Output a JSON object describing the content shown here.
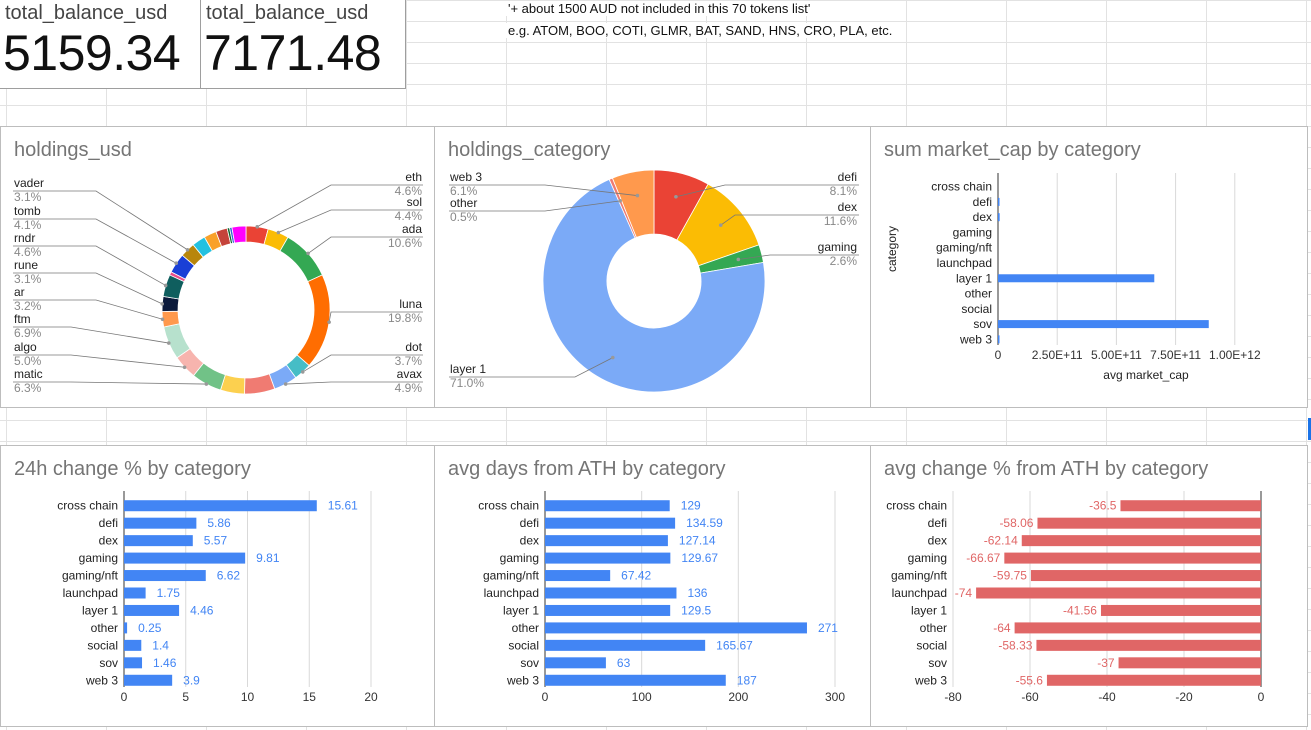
{
  "kpis": [
    {
      "label": "total_balance_usd",
      "value": "5159.34"
    },
    {
      "label": "total_balance_usd",
      "value": "7171.48"
    }
  ],
  "notes": {
    "line1": "'+ about 1500 AUD not included in this 70 tokens list'",
    "line2": "e.g. ATOM, BOO, COTI, GLMR, BAT, SAND, HNS, CRO, PLA, etc."
  },
  "panels": {
    "holdings_usd": {
      "title": "holdings_usd"
    },
    "holdings_category": {
      "title": "holdings_category"
    },
    "market_cap": {
      "title": "sum market_cap by category"
    },
    "change24h": {
      "title": "24h change % by category"
    },
    "ath_days": {
      "title": "avg days from ATH by category"
    },
    "ath_change": {
      "title": "avg change % from ATH by category"
    }
  },
  "chart_data": [
    {
      "id": "holdings_usd",
      "type": "pie",
      "title": "holdings_usd",
      "donut": true,
      "slices": [
        {
          "label": "eth",
          "value": 4.6,
          "pct": "4.6%",
          "color": "#ea4335"
        },
        {
          "label": "sol",
          "value": 4.4,
          "pct": "4.4%",
          "color": "#fbbc04"
        },
        {
          "label": "ada",
          "value": 10.6,
          "pct": "10.6%",
          "color": "#34a853"
        },
        {
          "label": "luna",
          "value": 19.8,
          "pct": "19.8%",
          "color": "#ff6d01"
        },
        {
          "label": "dot",
          "value": 3.7,
          "pct": "3.7%",
          "color": "#46bdc6"
        },
        {
          "label": "avax",
          "value": 4.9,
          "pct": "4.9%",
          "color": "#7baaf7"
        },
        {
          "label": "",
          "value": 6.3,
          "pct": "",
          "color": "#f07b72"
        },
        {
          "label": "",
          "value": 5.0,
          "pct": "",
          "color": "#fcd04f"
        },
        {
          "label": "matic",
          "value": 6.3,
          "pct": "6.3%",
          "color": "#71c287"
        },
        {
          "label": "algo",
          "value": 5.0,
          "pct": "5.0%",
          "color": "#f7b4ae"
        },
        {
          "label": "ftm",
          "value": 6.9,
          "pct": "6.9%",
          "color": "#b7e1cd"
        },
        {
          "label": "ar",
          "value": 3.2,
          "pct": "3.2%",
          "color": "#ff994d"
        },
        {
          "label": "rune",
          "value": 3.1,
          "pct": "3.1%",
          "color": "#0b1a3b"
        },
        {
          "label": "rndr",
          "value": 4.6,
          "pct": "4.6%",
          "color": "#0f5e5e"
        },
        {
          "label": "",
          "value": 0.7,
          "pct": "",
          "color": "#ea4c89"
        },
        {
          "label": "tomb",
          "value": 4.1,
          "pct": "4.1%",
          "color": "#1a3fd6"
        },
        {
          "label": "vader",
          "value": 3.1,
          "pct": "3.1%",
          "color": "#b8860b"
        },
        {
          "label": "",
          "value": 2.8,
          "pct": "",
          "color": "#24c1e0"
        },
        {
          "label": "",
          "value": 2.6,
          "pct": "",
          "color": "#f9a12a"
        },
        {
          "label": "",
          "value": 2.4,
          "pct": "",
          "color": "#c5443b"
        },
        {
          "label": "",
          "value": 0.5,
          "pct": "",
          "color": "#0d652d"
        },
        {
          "label": "",
          "value": 0.5,
          "pct": "",
          "color": "#3367d6"
        },
        {
          "label": "",
          "value": 2.9,
          "pct": "",
          "color": "#ff00ff"
        }
      ]
    },
    {
      "id": "holdings_category",
      "type": "pie",
      "title": "holdings_category",
      "donut": true,
      "slices": [
        {
          "label": "defi",
          "value": 8.1,
          "pct": "8.1%",
          "color": "#ea4335"
        },
        {
          "label": "dex",
          "value": 11.6,
          "pct": "11.6%",
          "color": "#fbbc04"
        },
        {
          "label": "gaming",
          "value": 2.6,
          "pct": "2.6%",
          "color": "#34a853"
        },
        {
          "label": "layer 1",
          "value": 71.0,
          "pct": "71.0%",
          "color": "#7baaf7"
        },
        {
          "label": "other",
          "value": 0.5,
          "pct": "0.5%",
          "color": "#f07b72"
        },
        {
          "label": "web 3",
          "value": 6.1,
          "pct": "6.1%",
          "color": "#ff994d"
        }
      ]
    },
    {
      "id": "market_cap",
      "type": "bar",
      "orientation": "horizontal",
      "title": "sum market_cap by category",
      "xlabel": "avg market_cap",
      "ylabel": "category",
      "categories": [
        "cross chain",
        "defi",
        "dex",
        "gaming",
        "gaming/nft",
        "launchpad",
        "layer 1",
        "other",
        "social",
        "sov",
        "web 3"
      ],
      "values": [
        0,
        4000000000,
        7000000000,
        0,
        0,
        0,
        660000000000,
        0,
        0,
        890000000000,
        2000000000
      ],
      "xlim": [
        0,
        1250000000000
      ],
      "ticks": [
        0,
        250000000000,
        500000000000,
        750000000000,
        1000000000000
      ],
      "tick_labels": [
        "0",
        "2.50E+11",
        "5.00E+11",
        "7.50E+11",
        "1.00E+12"
      ],
      "color": "#4285f4"
    },
    {
      "id": "change24h",
      "type": "bar",
      "orientation": "horizontal",
      "title": "24h change % by category",
      "categories": [
        "cross chain",
        "defi",
        "dex",
        "gaming",
        "gaming/nft",
        "launchpad",
        "layer 1",
        "other",
        "social",
        "sov",
        "web 3"
      ],
      "values": [
        15.61,
        5.86,
        5.57,
        9.81,
        6.62,
        1.75,
        4.46,
        0.25,
        1.4,
        1.46,
        3.9
      ],
      "labels": [
        "15.61",
        "5.86",
        "5.57",
        "9.81",
        "6.62",
        "1.75",
        "4.46",
        "0.25",
        "1.4",
        "1.46",
        "3.9"
      ],
      "xlim": [
        0,
        20
      ],
      "ticks": [
        0,
        5,
        10,
        15,
        20
      ],
      "tick_labels": [
        "0",
        "5",
        "10",
        "15",
        "20"
      ],
      "color": "#4285f4"
    },
    {
      "id": "ath_days",
      "type": "bar",
      "orientation": "horizontal",
      "title": "avg days from ATH by category",
      "categories": [
        "cross chain",
        "defi",
        "dex",
        "gaming",
        "gaming/nft",
        "launchpad",
        "layer 1",
        "other",
        "social",
        "sov",
        "web 3"
      ],
      "values": [
        129,
        134.59,
        127.14,
        129.67,
        67.42,
        136,
        129.5,
        271,
        165.67,
        63,
        187
      ],
      "labels": [
        "129",
        "134.59",
        "127.14",
        "129.67",
        "67.42",
        "136",
        "129.5",
        "271",
        "165.67",
        "63",
        "187"
      ],
      "xlim": [
        0,
        300
      ],
      "ticks": [
        0,
        100,
        200,
        300
      ],
      "tick_labels": [
        "0",
        "100",
        "200",
        "300"
      ],
      "color": "#4285f4"
    },
    {
      "id": "ath_change",
      "type": "bar",
      "orientation": "horizontal",
      "title": "avg change % from ATH by category",
      "categories": [
        "cross chain",
        "defi",
        "dex",
        "gaming",
        "gaming/nft",
        "launchpad",
        "layer 1",
        "other",
        "social",
        "sov",
        "web 3"
      ],
      "values": [
        -36.5,
        -58.06,
        -62.14,
        -66.67,
        -59.75,
        -74,
        -41.56,
        -64,
        -58.33,
        -37,
        -55.6
      ],
      "labels": [
        "-36.5",
        "-58.06",
        "-62.14",
        "-66.67",
        "-59.75",
        "-74",
        "-41.56",
        "-64",
        "-58.33",
        "-37",
        "-55.6"
      ],
      "xlim": [
        -80,
        0
      ],
      "ticks": [
        -80,
        -60,
        -40,
        -20,
        0
      ],
      "tick_labels": [
        "-80",
        "-60",
        "-40",
        "-20",
        "0"
      ],
      "color": "#e06666"
    }
  ]
}
